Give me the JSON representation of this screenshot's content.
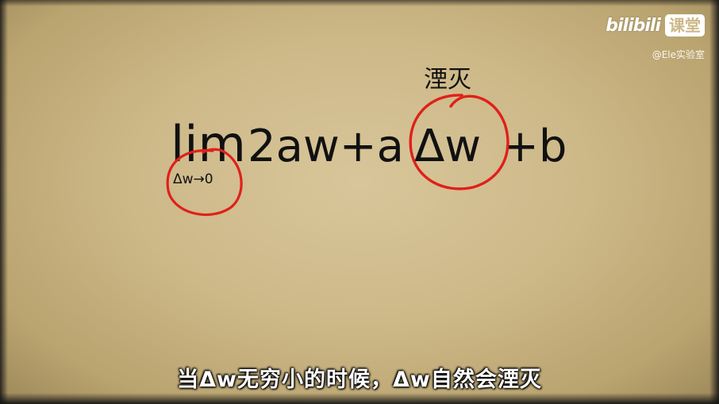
{
  "brand": {
    "name": "bilibili",
    "course_badge": "课堂",
    "uploader": "@Ele实验室"
  },
  "formula": {
    "lim": "lim",
    "limit_condition": "Δw→0",
    "terms": "2aw+a",
    "delta_w": "Δw",
    "tail": "+b",
    "annotation": "湮灭"
  },
  "subtitle": "当Δw无穷小的时候，Δw自然会湮灭",
  "colors": {
    "background": "#cdb888",
    "ink": "#111111",
    "circle": "#e0201b",
    "subtitle": "#ffffff"
  }
}
